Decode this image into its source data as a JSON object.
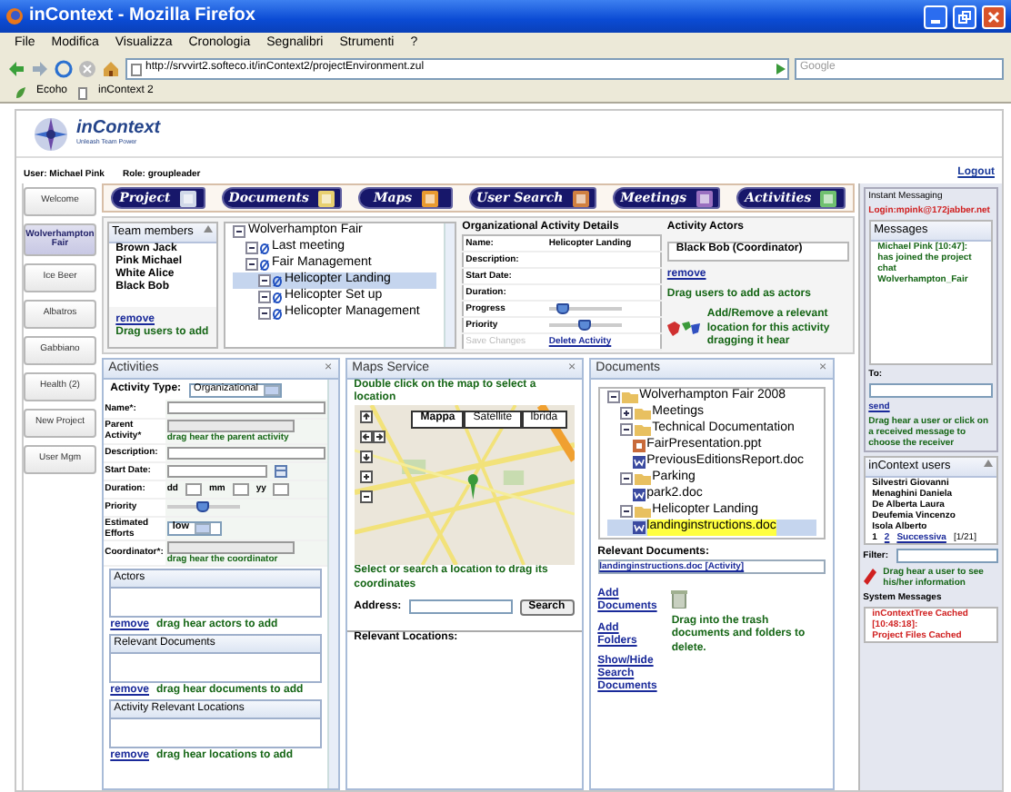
{
  "window": {
    "title": "inContext - Mozilla Firefox"
  },
  "menu": [
    "File",
    "Modifica",
    "Visualizza",
    "Cronologia",
    "Segnalibri",
    "Strumenti",
    "?"
  ],
  "address_bar": {
    "url": "http://srvvirt2.softeco.it/inContext2/projectEnvironment.zul"
  },
  "search": {
    "placeholder": "Google"
  },
  "bookmarks": [
    "Ecoho",
    "inContext 2"
  ],
  "app": {
    "logo": "inContext",
    "tagline": "Unleash Team Power",
    "user": "User: Michael Pink",
    "role": "Role: groupleader",
    "logout": "Logout"
  },
  "projects": [
    {
      "label": "Welcome",
      "selected": false
    },
    {
      "label": "Wolverhampton Fair",
      "selected": true
    },
    {
      "label": "Ice Beer",
      "selected": false
    },
    {
      "label": "Albatros",
      "selected": false
    },
    {
      "label": "Gabbiano",
      "selected": false
    },
    {
      "label": "Health (2)",
      "selected": false
    },
    {
      "label": "New Project",
      "selected": false
    },
    {
      "label": "User Mgm",
      "selected": false
    }
  ],
  "tabs": [
    "Project",
    "Documents",
    "Maps",
    "User Search",
    "Meetings",
    "Activities"
  ],
  "team": {
    "title": "Team members",
    "members": [
      "Brown Jack",
      "Pink Michael",
      "White Alice",
      "Black Bob"
    ],
    "remove": "remove",
    "hint": "Drag users to add"
  },
  "activity_tree": [
    {
      "label": "Wolverhampton Fair",
      "expanded": true,
      "selected": false,
      "children": [
        {
          "label": "Last meeting",
          "expanded": true,
          "selected": false
        },
        {
          "label": "Fair Management",
          "expanded": true,
          "selected": false,
          "children": [
            {
              "label": "Helicopter Landing",
              "expanded": true,
              "selected": true
            },
            {
              "label": "Helicopter Set up",
              "expanded": true,
              "selected": false
            },
            {
              "label": "Helicopter Management",
              "expanded": true,
              "selected": false
            }
          ]
        }
      ]
    }
  ],
  "activity_details": {
    "title": "Organizational Activity Details",
    "fields": [
      {
        "label": "Name:",
        "kind": "text",
        "value": "Helicopter Landing"
      },
      {
        "label": "Description:",
        "kind": "text"
      },
      {
        "label": "Start Date:",
        "kind": "text"
      },
      {
        "label": "Duration:",
        "kind": "text"
      },
      {
        "label": "Progress",
        "kind": "slider",
        "level": 0.1
      },
      {
        "label": "Priority",
        "kind": "slider",
        "level": 0.5
      }
    ],
    "save": "Save Changes",
    "save_disabled": true,
    "delete": "Delete Activity"
  },
  "actors": {
    "title": "Activity Actors",
    "items": [
      "Black Bob (Coordinator)"
    ],
    "remove": "remove",
    "hint": "Drag users to add as actors",
    "location_hint": "Add/Remove a relevant location for this activity dragging it hear"
  },
  "activities_panel": {
    "title": "Activities",
    "close": "×",
    "type_label": "Activity Type:",
    "type_value": "Organizational",
    "fields": [
      {
        "label": "Name*:",
        "kind": "input"
      },
      {
        "label": "Parent Activity*",
        "kind": "disabled",
        "hint": "drag hear the parent activity"
      },
      {
        "label": "Description:",
        "kind": "input"
      },
      {
        "label": "Start Date:",
        "kind": "date"
      },
      {
        "label": "Duration:",
        "kind": "duration",
        "parts": [
          "dd",
          "mm",
          "yy"
        ]
      },
      {
        "label": "Priority",
        "kind": "slider",
        "level": 0.5
      },
      {
        "label": "Estimated Efforts",
        "kind": "select",
        "value": "low"
      },
      {
        "label": "Coordinator*:",
        "kind": "disabled",
        "hint": "drag hear the coordinator"
      }
    ],
    "lists": [
      {
        "title": "Actors",
        "remove": "remove",
        "hint": "drag hear actors to add"
      },
      {
        "title": "Relevant Documents",
        "remove": "remove",
        "hint": "drag hear documents to add"
      },
      {
        "title": "Activity Relevant Locations",
        "remove": "remove",
        "hint": "drag hear locations to add"
      }
    ]
  },
  "maps": {
    "title": "Maps Service",
    "close": "×",
    "hint": "Double click on the map to select a location",
    "map_types": [
      {
        "label": "Mappa",
        "selected": true
      },
      {
        "label": "Satellite",
        "selected": false
      },
      {
        "label": "Ibrida",
        "selected": false
      }
    ],
    "select_hint": "Select or search a location to drag its coordinates",
    "address_label": "Address:",
    "search_button": "Search",
    "relevant": "Relevant Locations:"
  },
  "documents": {
    "title": "Documents",
    "close": "×",
    "tree": [
      {
        "label": "Wolverhampton Fair 2008",
        "kind": "folder",
        "expanded": true,
        "selected": false,
        "children": [
          {
            "label": "Meetings",
            "kind": "folder",
            "expanded": false,
            "selected": false
          },
          {
            "label": "Technical Documentation",
            "kind": "folder",
            "expanded": true,
            "selected": false,
            "children": [
              {
                "label": "FairPresentation.ppt",
                "kind": "ppt",
                "selected": false
              },
              {
                "label": "PreviousEditionsReport.doc",
                "kind": "doc",
                "selected": false
              }
            ]
          },
          {
            "label": "Parking",
            "kind": "folder",
            "expanded": true,
            "selected": false,
            "children": [
              {
                "label": "park2.doc",
                "kind": "doc",
                "selected": false
              }
            ]
          },
          {
            "label": "Helicopter Landing",
            "kind": "folder",
            "expanded": true,
            "selected": false,
            "children": [
              {
                "label": "landinginstructions.doc",
                "kind": "doc",
                "selected": true
              }
            ]
          }
        ]
      }
    ],
    "relevant_label": "Relevant Documents:",
    "relevant_value": "landinginstructions.doc [Activity]",
    "links": [
      "Add Documents",
      "Add Folders",
      "Show/Hide Search Documents"
    ],
    "trash_hint": "Drag into the trash documents and folders to delete."
  },
  "chat": {
    "title": "Instant Messaging",
    "login": "Login:mpink@172jabber.net",
    "messages_title": "Messages",
    "messages": [
      {
        "from": "Michael Pink [10:47]:",
        "text": "has joined the project chat Wolverhampton_Fair"
      }
    ],
    "to_label": "To:",
    "send": "send",
    "hint": "Drag hear a user or click on a received message to choose the receiver"
  },
  "users": {
    "title": "inContext users",
    "items": [
      "Silvestri Giovanni",
      "Menaghini Daniela",
      "De Alberta Laura",
      "Deufemia Vincenzo",
      "Isola Alberto"
    ],
    "pages": [
      "1",
      "2"
    ],
    "next": "Successiva",
    "count": "[1/21]",
    "filter_label": "Filter:",
    "hint": "Drag hear a user to see his/her information"
  },
  "system": {
    "title": "System Messages",
    "messages": [
      "inContextTree Cached",
      "[10:48:18]:",
      "Project Files Cached"
    ]
  }
}
